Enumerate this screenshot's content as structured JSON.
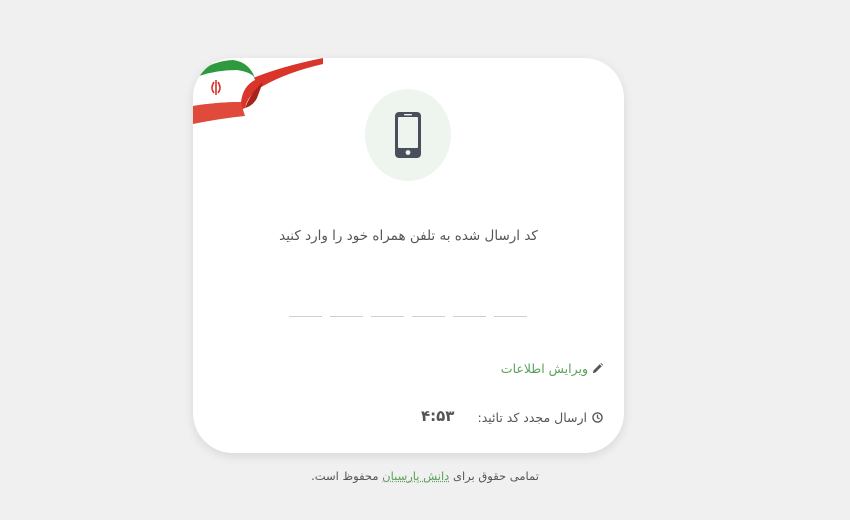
{
  "icons": {
    "flag": "iran-flag-ribbon-icon",
    "phone": "mobile-phone-icon",
    "edit": "pencil-icon",
    "timer": "clock-icon"
  },
  "colors": {
    "background": "#f0f0f0",
    "card": "#ffffff",
    "accent": "#5aa05a",
    "phone_circle": "#eef4ee",
    "phone_icon": "#4a4f5c",
    "text": "#555555"
  },
  "verify": {
    "title": "کد ارسال شده به تلفن همراه خود را وارد کنید",
    "digits": [
      "",
      "",
      "",
      "",
      "",
      ""
    ],
    "edit_label": "ویرایش اطلاعات",
    "resend_label": "ارسال مجدد کد تائید:",
    "timer": "۴:۵۳"
  },
  "footer": {
    "prefix": "تمامی حقوق برای",
    "link": "دانش پارسیان",
    "suffix": "محفوظ است."
  }
}
